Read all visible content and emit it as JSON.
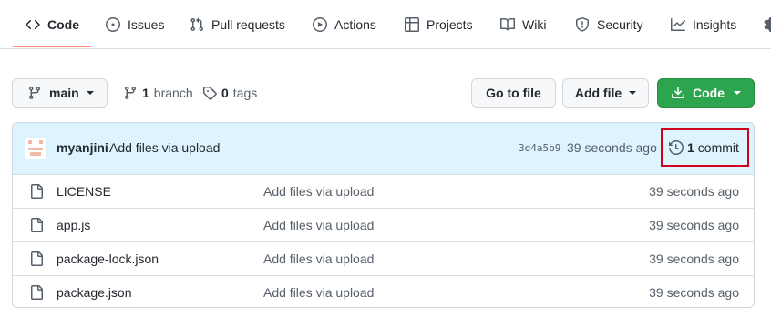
{
  "nav": {
    "tabs": [
      {
        "label": "Code",
        "icon": "code-icon"
      },
      {
        "label": "Issues",
        "icon": "issue-opened-icon"
      },
      {
        "label": "Pull requests",
        "icon": "git-pull-request-icon"
      },
      {
        "label": "Actions",
        "icon": "play-icon"
      },
      {
        "label": "Projects",
        "icon": "table-icon"
      },
      {
        "label": "Wiki",
        "icon": "book-icon"
      },
      {
        "label": "Security",
        "icon": "shield-icon"
      },
      {
        "label": "Insights",
        "icon": "graph-icon"
      }
    ],
    "active_tab": "Code",
    "accent_color": "#fd8c73"
  },
  "toolbar": {
    "branch_label": "main",
    "branch_count": "1",
    "branch_word": "branch",
    "tag_count": "0",
    "tag_word": "tags",
    "go_to_file": "Go to file",
    "add_file": "Add file",
    "code_button": "Code",
    "code_button_color": "#2da44e"
  },
  "commit": {
    "author": "myanjini",
    "message": "Add files via upload",
    "sha": "3d4a5b9",
    "time": "39 seconds ago",
    "count": "1",
    "count_word": "commit",
    "bar_color": "#ddf4ff",
    "highlight_color": "#d0021b"
  },
  "files": [
    {
      "name": "LICENSE",
      "message": "Add files via upload",
      "time": "39 seconds ago",
      "icon": "file-icon"
    },
    {
      "name": "app.js",
      "message": "Add files via upload",
      "time": "39 seconds ago",
      "icon": "file-icon"
    },
    {
      "name": "package-lock.json",
      "message": "Add files via upload",
      "time": "39 seconds ago",
      "icon": "file-icon"
    },
    {
      "name": "package.json",
      "message": "Add files via upload",
      "time": "39 seconds ago",
      "icon": "file-icon"
    }
  ]
}
